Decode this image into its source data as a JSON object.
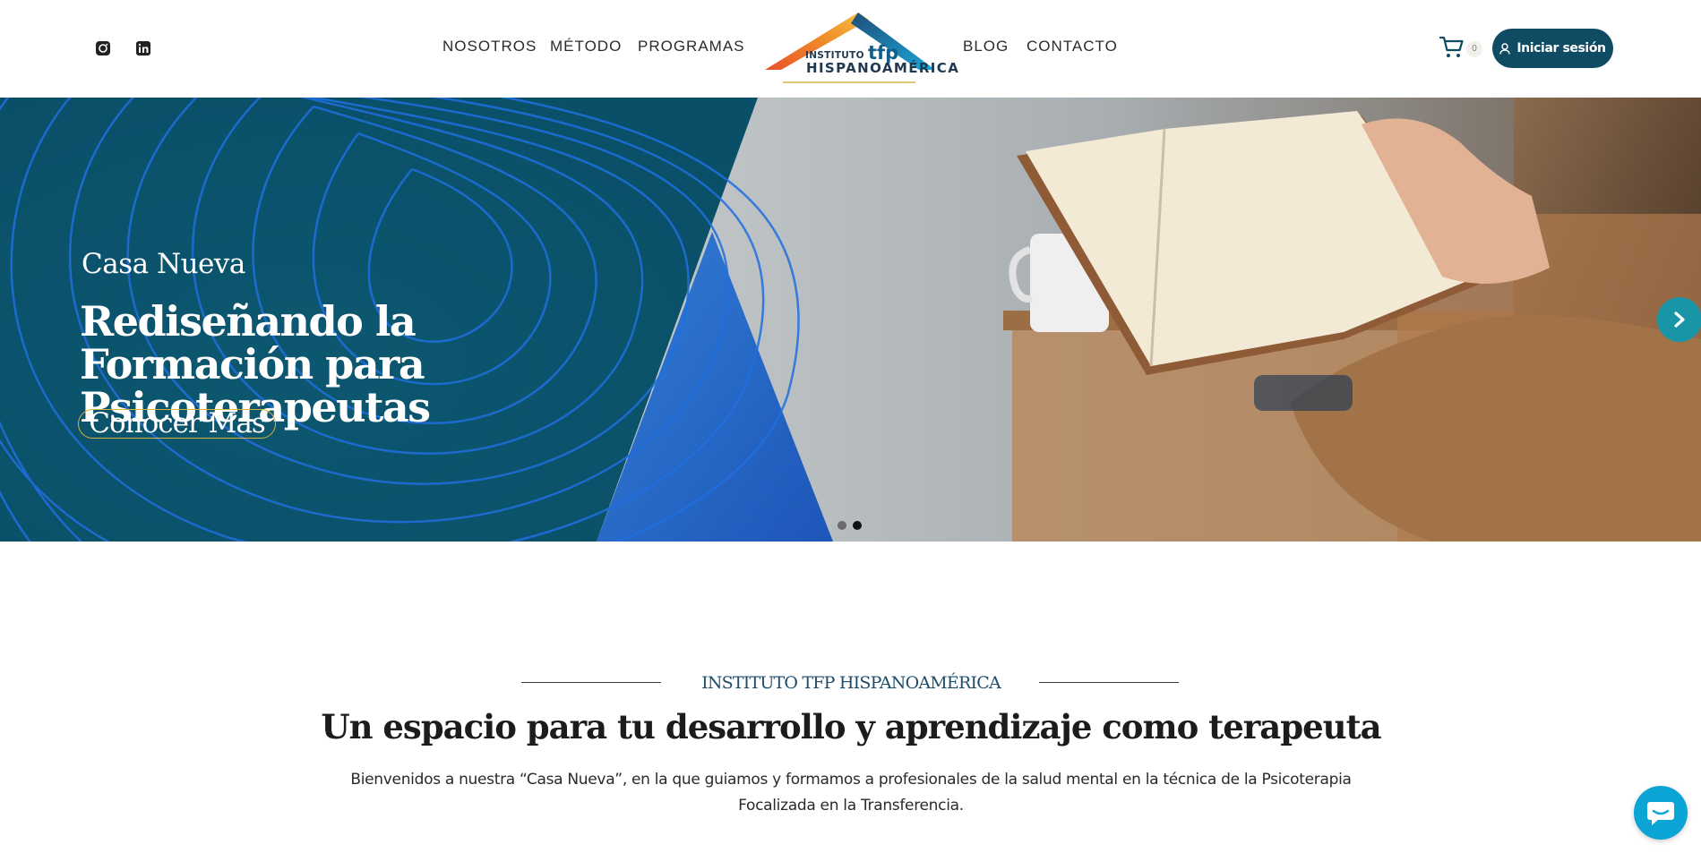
{
  "header": {
    "social": [
      {
        "name": "instagram-icon"
      },
      {
        "name": "linkedin-icon"
      }
    ],
    "nav_left": [
      "NOSOTROS",
      "MÉTODO",
      "PROGRAMAS"
    ],
    "nav_right": [
      "BLOG",
      "CONTACTO"
    ],
    "logo": {
      "instituto": "INSTITUTO",
      "tfp": "tfp",
      "wordmark": "HISPANOAMÉRICA"
    },
    "cart_count": "0",
    "login_label": "Iniciar sesión"
  },
  "hero": {
    "kicker": "Casa Nueva",
    "title": "Rediseñando la Formación para Psicoterapeutas",
    "cta": "Conocer Más",
    "slides_total": 2,
    "active_slide": 2
  },
  "intro": {
    "kicker": "INSTITUTO TFP HISPANOAMÉRICA",
    "title": "Un espacio para tu desarrollo y aprendizaje como terapeuta",
    "body": "Bienvenidos a nuestra “Casa Nueva”, en la que guiamos y formamos a profesionales de la salud mental en la técnica de la Psicoterapia Focalizada en la Transferencia."
  },
  "colors": {
    "brand_dark": "#0f4b63",
    "hero_panel": "#0b5670",
    "accent_gold": "#d8b43e",
    "chat": "#0aa5d4"
  }
}
